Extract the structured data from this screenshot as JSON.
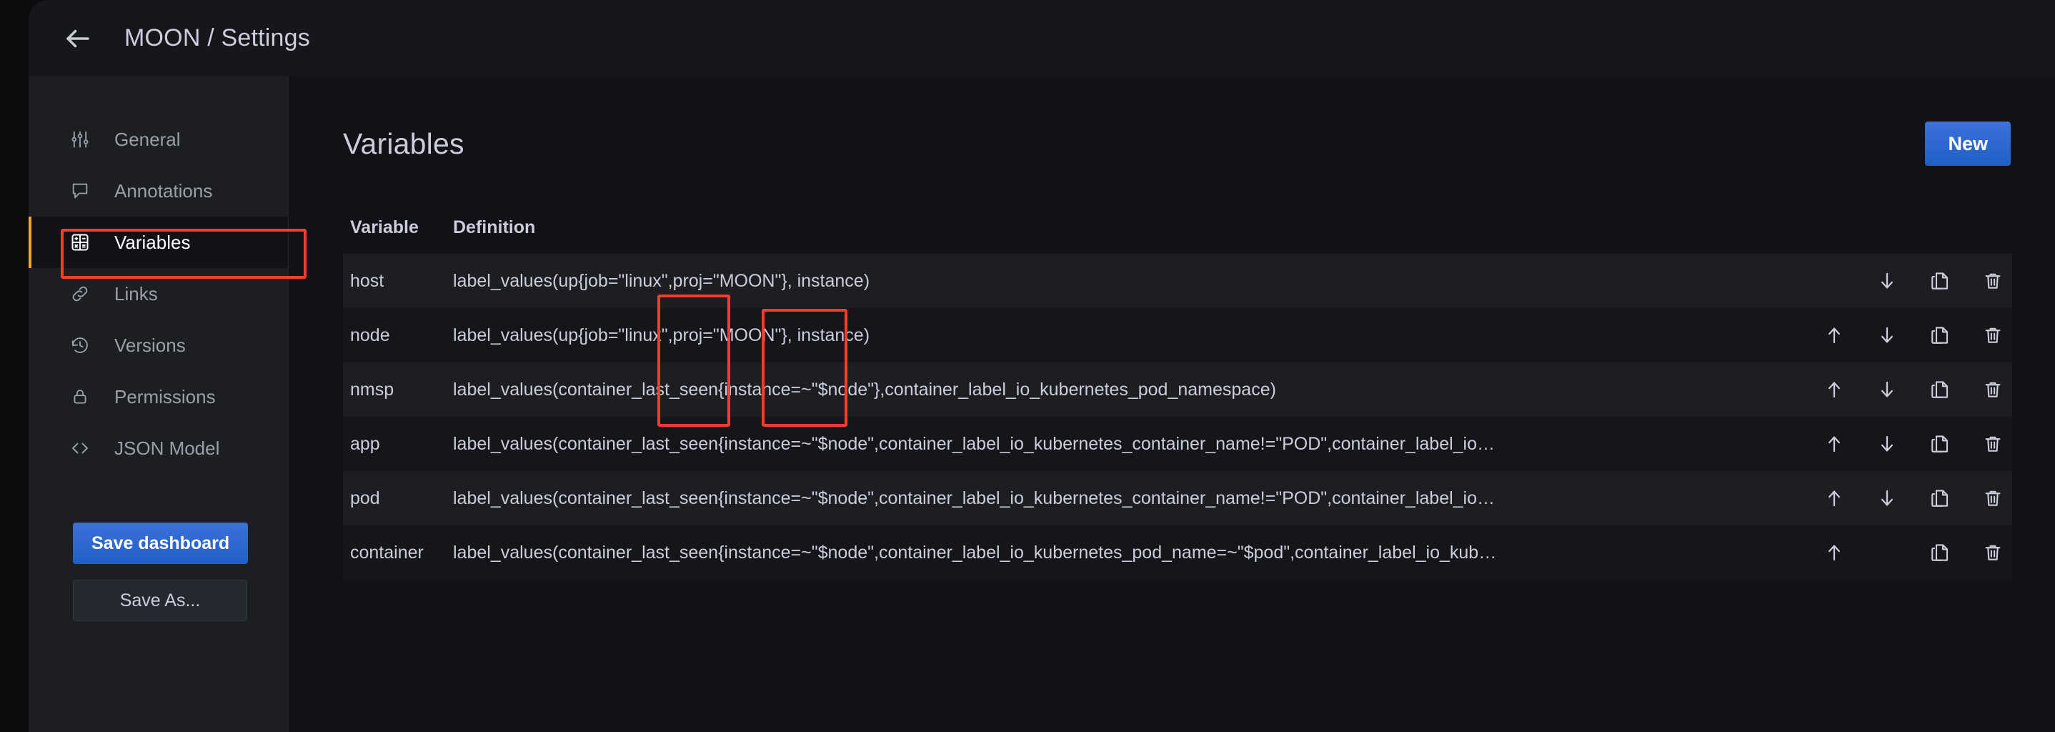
{
  "topbar": {
    "back_icon": "arrow-left-icon",
    "breadcrumb": "MOON / Settings"
  },
  "sidebar": {
    "items": [
      {
        "label": "General",
        "icon": "sliders-icon",
        "active": false
      },
      {
        "label": "Annotations",
        "icon": "comment-icon",
        "active": false
      },
      {
        "label": "Variables",
        "icon": "table-grid-icon",
        "active": true
      },
      {
        "label": "Links",
        "icon": "link-chain-icon",
        "active": false
      },
      {
        "label": "Versions",
        "icon": "history-clock-icon",
        "active": false
      },
      {
        "label": "Permissions",
        "icon": "lock-icon",
        "active": false
      },
      {
        "label": "JSON Model",
        "icon": "code-brackets-icon",
        "active": false
      }
    ],
    "save_dashboard_label": "Save dashboard",
    "save_as_label": "Save As..."
  },
  "main": {
    "title": "Variables",
    "new_button_label": "New",
    "table": {
      "columns": [
        "Variable",
        "Definition",
        ""
      ],
      "rows": [
        {
          "name": "host",
          "definition": "label_values(up{job=\"linux\",proj=\"MOON\"}, instance)",
          "has_up": false,
          "has_down": true
        },
        {
          "name": "node",
          "definition": "label_values(up{job=\"linux\",proj=\"MOON\"}, instance)",
          "has_up": true,
          "has_down": true
        },
        {
          "name": "nmsp",
          "definition": "label_values(container_last_seen{instance=~\"$node\"},container_label_io_kubernetes_pod_namespace)",
          "has_up": true,
          "has_down": true
        },
        {
          "name": "app",
          "definition": "label_values(container_last_seen{instance=~\"$node\",container_label_io_kubernetes_container_name!=\"POD\",container_label_io…",
          "has_up": true,
          "has_down": true
        },
        {
          "name": "pod",
          "definition": "label_values(container_last_seen{instance=~\"$node\",container_label_io_kubernetes_container_name!=\"POD\",container_label_io…",
          "has_up": true,
          "has_down": true
        },
        {
          "name": "container",
          "definition": "label_values(container_last_seen{instance=~\"$node\",container_label_io_kubernetes_pod_name=~\"$pod\",container_label_io_kub…",
          "has_up": true,
          "has_down": false
        }
      ],
      "row_action_icons": [
        "arrow-up-icon",
        "arrow-down-icon",
        "duplicate-icon",
        "trash-icon"
      ]
    }
  },
  "annotations": {
    "highlight_color": "#fb3b2e",
    "boxes": [
      {
        "name": "variables-nav-highlight",
        "target": "Variables"
      },
      {
        "name": "job-label-highlight",
        "target": "job=\"linux\""
      },
      {
        "name": "proj-label-highlight",
        "target": "proj=\"MOON\""
      }
    ]
  }
}
